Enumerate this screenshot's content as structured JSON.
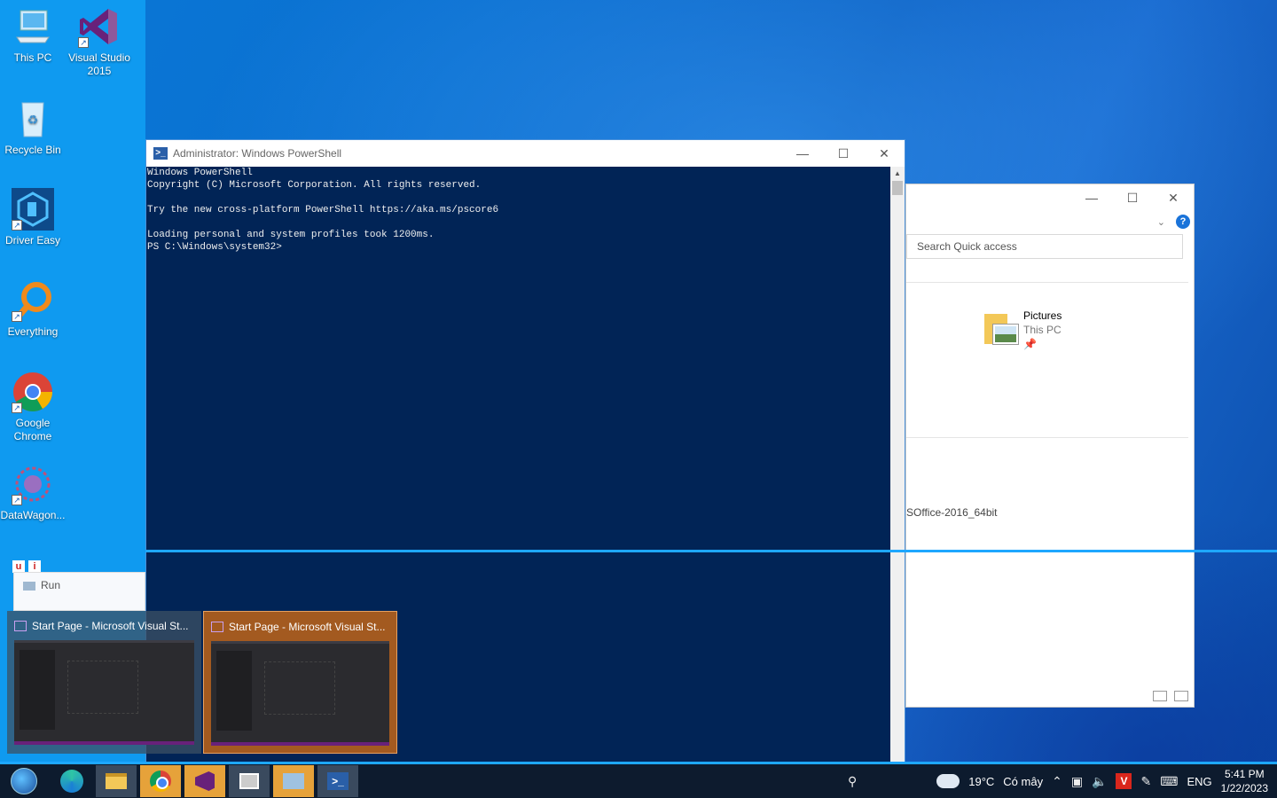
{
  "desktop": {
    "icons": [
      {
        "label": "This PC"
      },
      {
        "label": "Visual Studio 2015"
      },
      {
        "label": "Recycle Bin"
      },
      {
        "label": "Driver Easy"
      },
      {
        "label": "Everything"
      },
      {
        "label": "Google Chrome"
      },
      {
        "label": "DataWagon..."
      }
    ]
  },
  "powershell": {
    "title": "Administrator: Windows PowerShell",
    "output": "Windows PowerShell\nCopyright (C) Microsoft Corporation. All rights reserved.\n\nTry the new cross-platform PowerShell https://aka.ms/pscore6\n\nLoading personal and system profiles took 1200ms.\nPS C:\\Windows\\system32>",
    "title_icon": "powershell-icon"
  },
  "explorer": {
    "search_placeholder": "Search Quick access",
    "item_name": "Pictures",
    "item_location": "This PC",
    "file_name": "SOffice-2016_64bit"
  },
  "run_popup": {
    "label": "Run"
  },
  "thumbnails": [
    {
      "title": "Start Page - Microsoft Visual St..."
    },
    {
      "title": "Start Page - Microsoft Visual St..."
    }
  ],
  "taskbar": {
    "weather_temp": "19°C",
    "weather_desc": "Có mây",
    "language": "ENG",
    "time": "5:41 PM",
    "date": "1/22/2023"
  },
  "colors": {
    "powershell_bg": "#012456",
    "taskbar_bg": "#0d1b2e",
    "active_taskbar": "#e6a23a",
    "accent_line": "#1ea7ff"
  }
}
